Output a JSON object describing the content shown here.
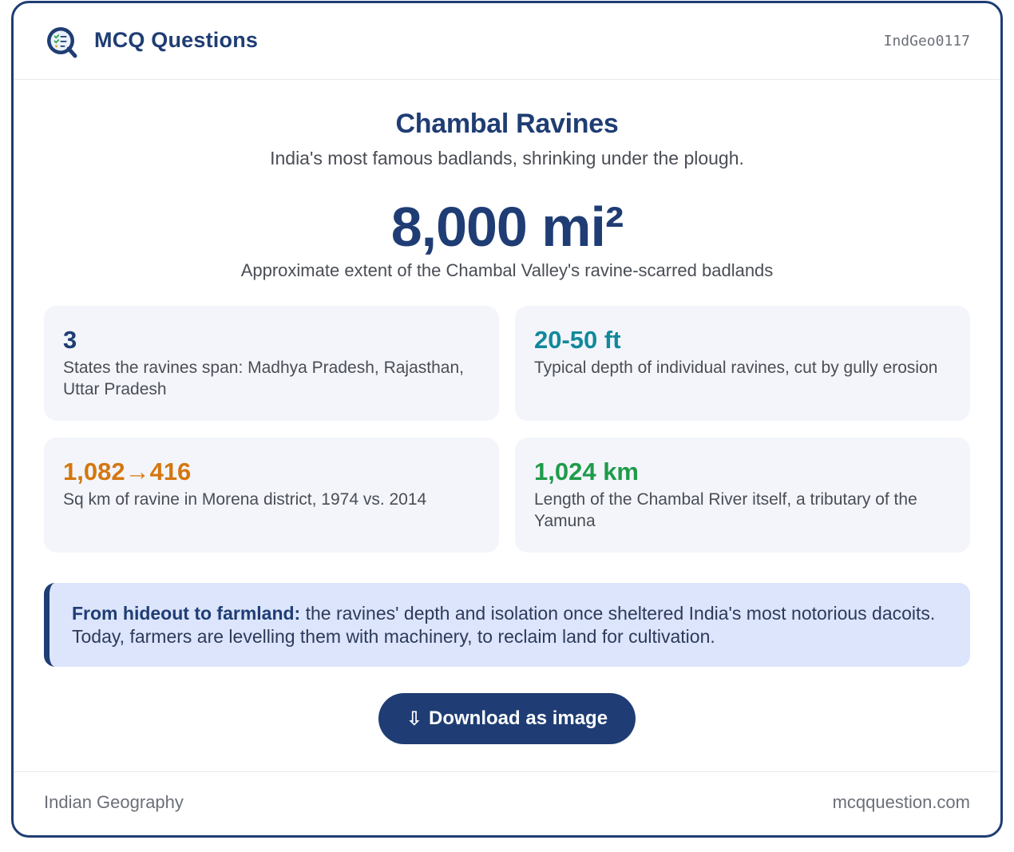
{
  "header": {
    "logo_icon": "quiz-checklist-icon",
    "brand": "MCQ Questions",
    "code": "IndGeo0117"
  },
  "main": {
    "title": "Chambal Ravines",
    "subtitle": "India's most famous badlands, shrinking under the plough.",
    "big_stat": "8,000 mi²",
    "big_caption": "Approximate extent of the Chambal Valley's ravine-scarred badlands"
  },
  "stats": [
    {
      "value": "3",
      "desc": "States the ravines span: Madhya Pradesh, Rajasthan, Uttar Pradesh",
      "color": "#1f3d74"
    },
    {
      "value": "20-50 ft",
      "desc": "Typical depth of individual ravines, cut by gully erosion",
      "color": "#12899a"
    },
    {
      "value": "1,082→416",
      "desc": "Sq km of ravine in Morena district, 1974 vs. 2014",
      "color": "#d4770f"
    },
    {
      "value": "1,024 km",
      "desc": "Length of the Chambal River itself, a tributary of the Yamuna",
      "color": "#1f9b4a"
    }
  ],
  "note": {
    "lead": "From hideout to farmland:",
    "body": " the ravines' depth and isolation once sheltered India's most notorious dacoits. Today, farmers are levelling them with machinery, to reclaim land for cultivation."
  },
  "download": {
    "icon": "⇩",
    "label": "Download as image"
  },
  "footer": {
    "category": "Indian Geography",
    "site": "mcqquestion.com"
  },
  "colors": {
    "accent": "#1f3d74",
    "note_bg": "#dce5fb",
    "box_bg": "#f3f5fb"
  }
}
